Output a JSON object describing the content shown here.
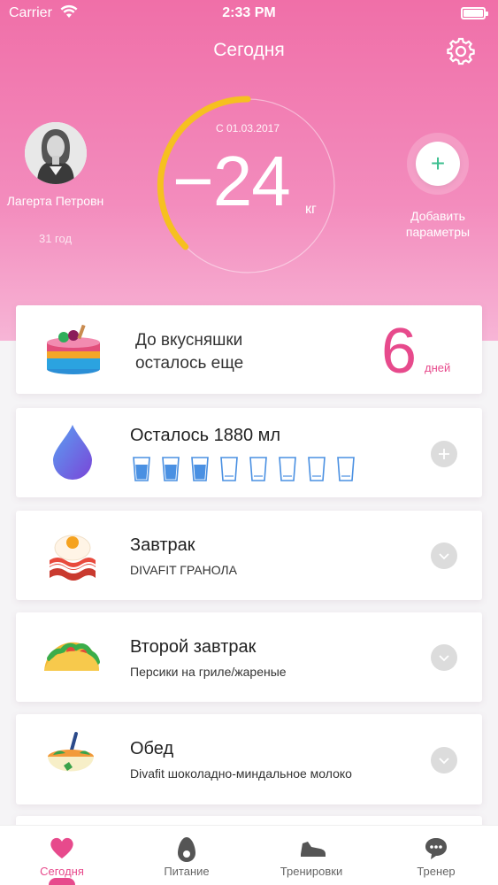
{
  "status_bar": {
    "carrier": "Carrier",
    "time": "2:33 PM"
  },
  "header": {
    "title": "Сегодня"
  },
  "profile": {
    "name": "Лагерта Петровн",
    "age": "31 год"
  },
  "progress": {
    "since": "С 01.03.2017",
    "value": "−24",
    "unit": "кг"
  },
  "add_params": {
    "label": "Добавить параметры",
    "icon": "+"
  },
  "treat_card": {
    "text_line1": "До вкусняшки",
    "text_line2": "осталось еще",
    "days": "6",
    "days_label": "дней"
  },
  "water_card": {
    "title": "Осталось 1880 мл",
    "glasses_filled": 3,
    "glasses_total": 8
  },
  "meals": [
    {
      "title": "Завтрак",
      "subtitle": "DIVAFIT ГРАНОЛА",
      "icon": "egg-bacon-icon"
    },
    {
      "title": "Второй завтрак",
      "subtitle": "Персики на гриле/жареные",
      "icon": "taco-icon"
    },
    {
      "title": "Обед",
      "subtitle": "Divafit шоколадно-миндальное молоко",
      "icon": "soup-bowl-icon"
    }
  ],
  "tabs": [
    {
      "label": "Сегодня",
      "icon": "heart-icon",
      "active": true
    },
    {
      "label": "Питание",
      "icon": "avocado-icon",
      "active": false
    },
    {
      "label": "Тренировки",
      "icon": "sneaker-icon",
      "active": false
    },
    {
      "label": "Тренер",
      "icon": "chat-bubble-icon",
      "active": false
    }
  ],
  "colors": {
    "accent": "#e74a8c",
    "gauge": "#f6c020",
    "add_green": "#3cbf8f"
  }
}
